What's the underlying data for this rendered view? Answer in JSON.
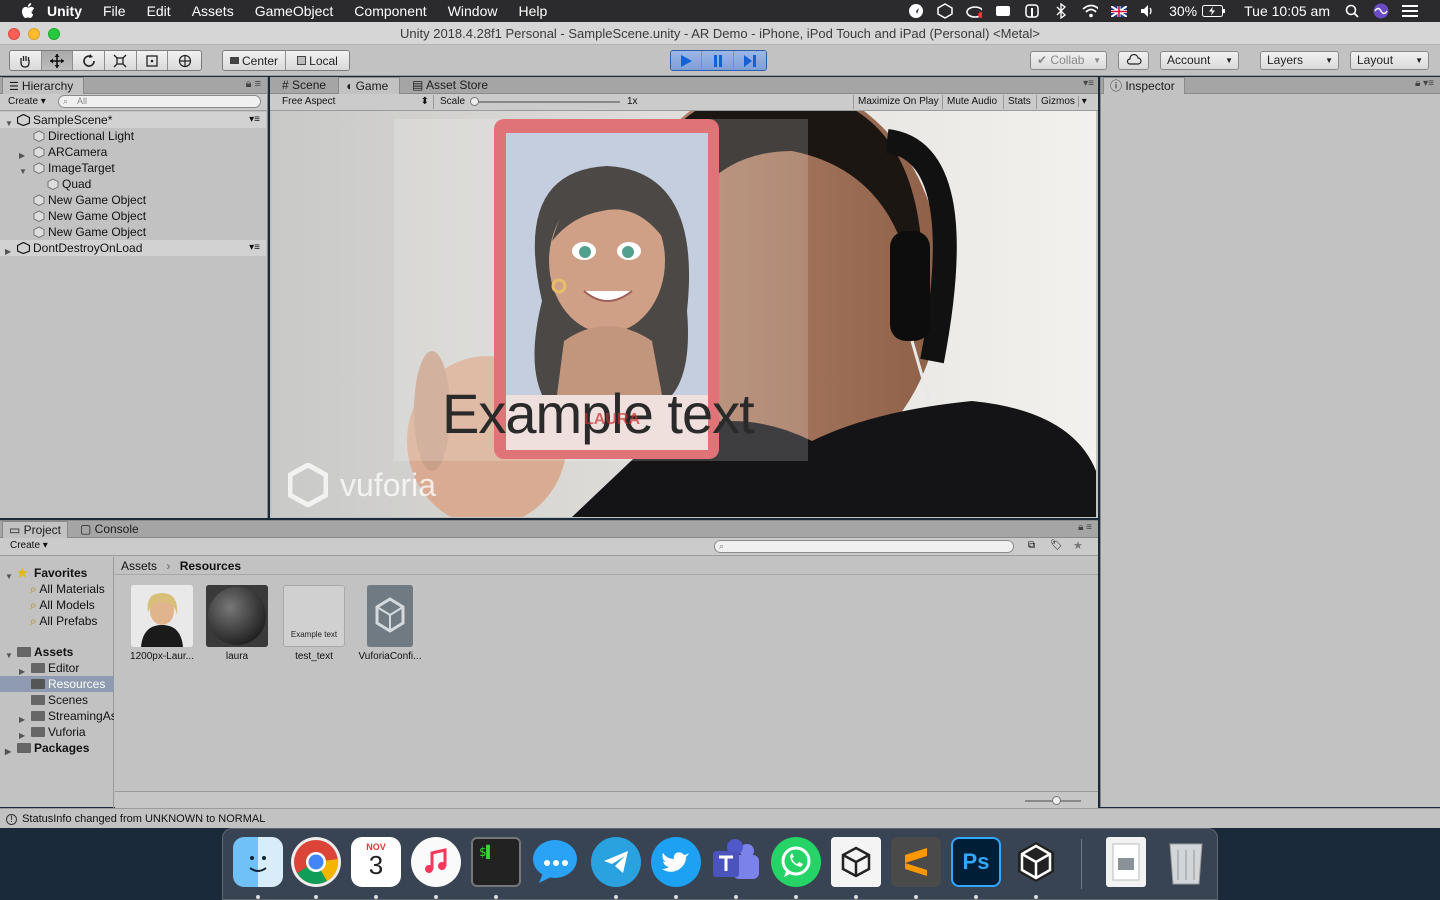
{
  "menubar": {
    "app": "Unity",
    "items": [
      "File",
      "Edit",
      "Assets",
      "GameObject",
      "Component",
      "Window",
      "Help"
    ],
    "battery": "30%",
    "clock": "Tue 10:05 am"
  },
  "window": {
    "title": "Unity 2018.4.28f1 Personal - SampleScene.unity - AR Demo - iPhone, iPod Touch and iPad (Personal) <Metal>"
  },
  "toolbar": {
    "pivot_center": "Center",
    "pivot_local": "Local",
    "collab": "Collab",
    "account": "Account",
    "layers": "Layers",
    "layout": "Layout"
  },
  "hierarchy": {
    "tab": "Hierarchy",
    "create": "Create",
    "search_placeholder": "All",
    "scene": "SampleScene*",
    "items": [
      "Directional Light",
      "ARCamera",
      "ImageTarget",
      "Quad",
      "New Game Object",
      "New Game Object",
      "New Game Object"
    ],
    "dont_destroy": "DontDestroyOnLoad"
  },
  "game": {
    "tabs": [
      "Scene",
      "Game",
      "Asset Store"
    ],
    "aspect": "Free Aspect",
    "scale_label": "Scale",
    "scale_value": "1x",
    "maximize": "Maximize On Play",
    "mute": "Mute Audio",
    "stats": "Stats",
    "gizmos": "Gizmos",
    "overlay_text": "Example text",
    "watermark": "vuforia",
    "card_name": "LAURA"
  },
  "inspector": {
    "tab": "Inspector"
  },
  "project": {
    "tabs": [
      "Project",
      "Console"
    ],
    "create": "Create",
    "breadcrumb": [
      "Assets",
      "Resources"
    ],
    "favorites": "Favorites",
    "favorite_items": [
      "All Materials",
      "All Models",
      "All Prefabs"
    ],
    "assets_root": "Assets",
    "asset_folders": [
      "Editor",
      "Resources",
      "Scenes",
      "StreamingAs",
      "Vuforia"
    ],
    "packages": "Packages",
    "files": [
      {
        "name": "1200px-Laur..."
      },
      {
        "name": "laura"
      },
      {
        "name": "test_text",
        "preview": "Example text"
      },
      {
        "name": "VuforiaConfi..."
      }
    ]
  },
  "status": {
    "message": "StatusInfo changed from UNKNOWN to NORMAL"
  },
  "dock": {
    "calendar_month": "NOV",
    "calendar_day": "3",
    "apps": [
      "Finder",
      "Chrome",
      "Calendar",
      "Music",
      "Terminal",
      "Messenger",
      "Telegram",
      "Twitter",
      "Teams",
      "WhatsApp",
      "Unity",
      "Sublime Text",
      "Photoshop",
      "Unity Hub",
      "Preview",
      "Trash"
    ]
  },
  "colors": {
    "play_blue": "#2f7de1",
    "panel_gray": "#c2c2c2",
    "selected_row": "#8e9bb0"
  }
}
